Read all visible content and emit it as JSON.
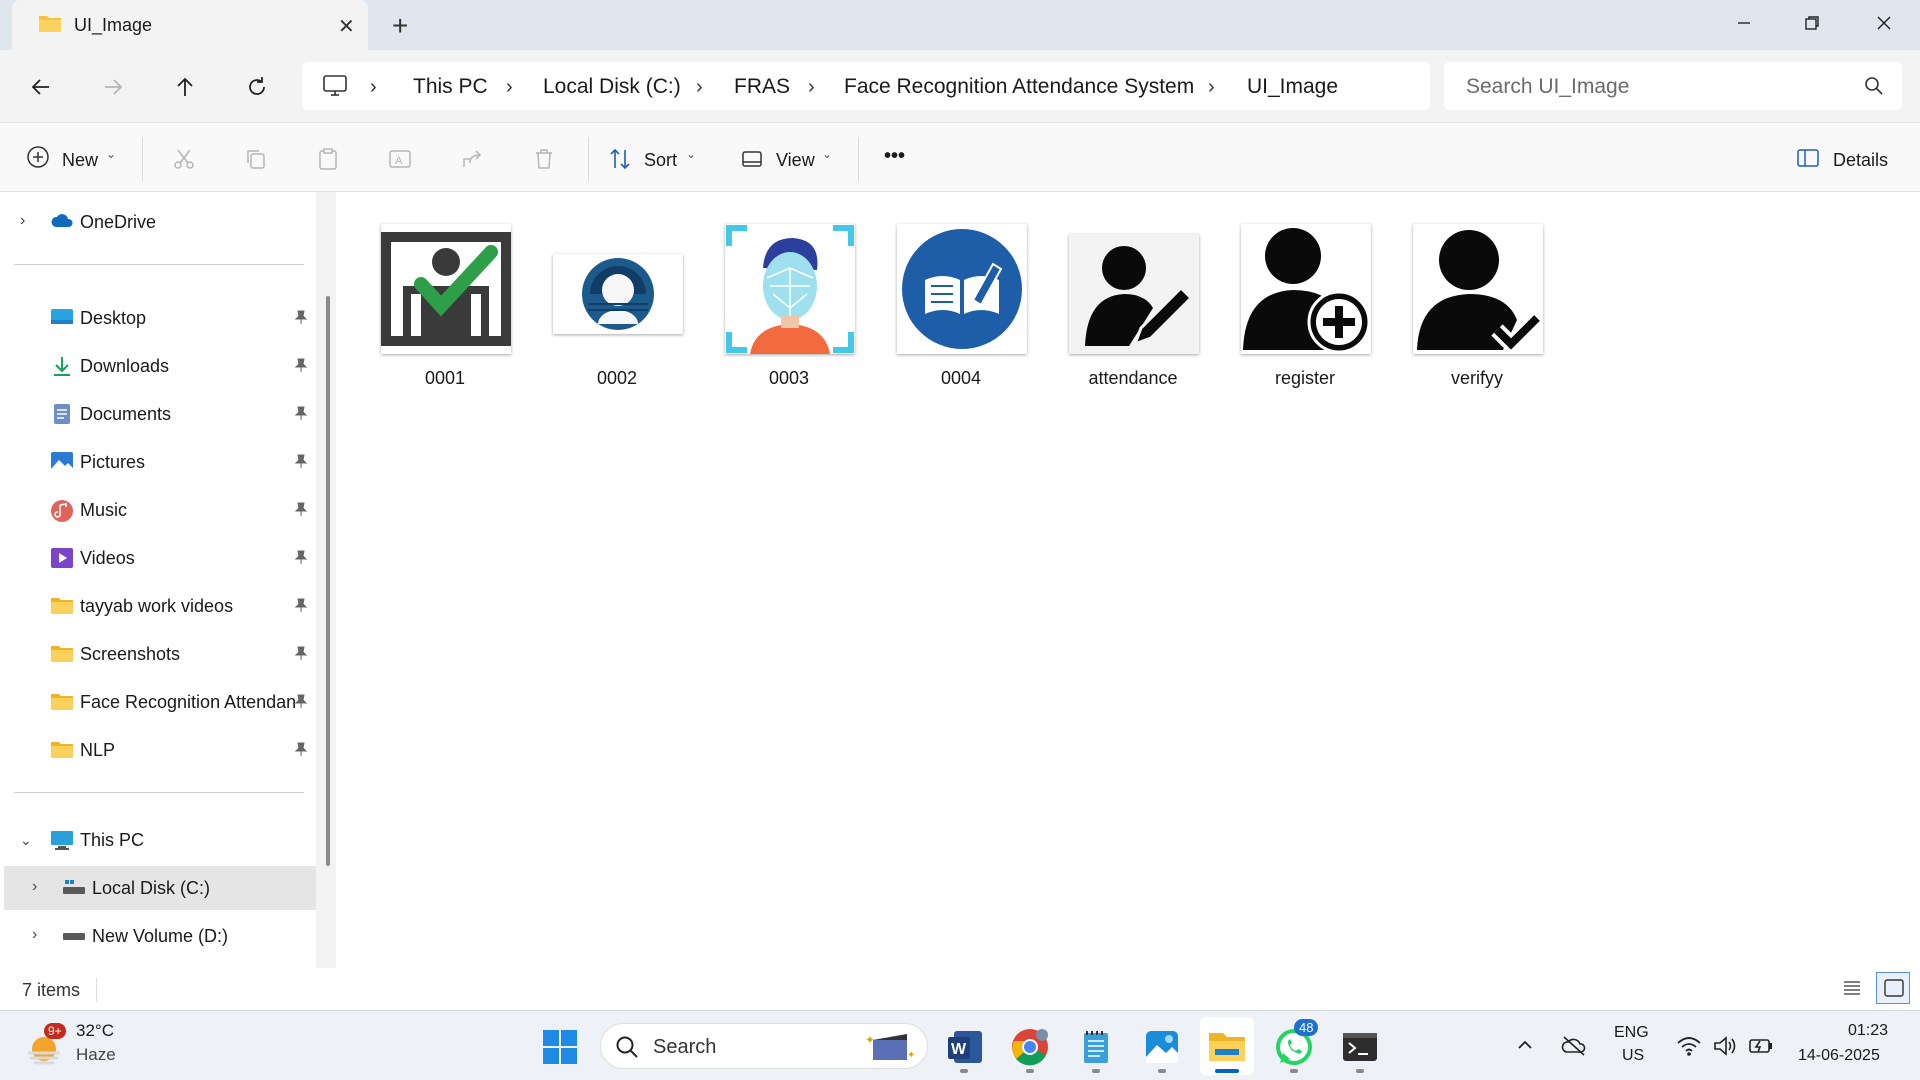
{
  "window": {
    "tab_title": "UI_Image",
    "new_tab_symbol": "+",
    "close_tab_symbol": "✕"
  },
  "nav": {
    "back": "arrow-left-icon",
    "forward": "arrow-right-icon",
    "up": "arrow-up-icon",
    "refresh": "refresh-icon"
  },
  "breadcrumb": [
    "This PC",
    "Local Disk (C:)",
    "FRAS",
    "Face Recognition Attendance System",
    "UI_Image"
  ],
  "search": {
    "placeholder": "Search UI_Image"
  },
  "toolbar": {
    "new_label": "New",
    "sort_label": "Sort",
    "view_label": "View",
    "more_label": "•••",
    "details_label": "Details"
  },
  "sidebar": {
    "onedrive": "OneDrive",
    "quick_access": [
      {
        "label": "Desktop",
        "icon": "desktop-icon"
      },
      {
        "label": "Downloads",
        "icon": "download-icon"
      },
      {
        "label": "Documents",
        "icon": "documents-icon"
      },
      {
        "label": "Pictures",
        "icon": "pictures-icon"
      },
      {
        "label": "Music",
        "icon": "music-icon"
      },
      {
        "label": "Videos",
        "icon": "videos-icon"
      },
      {
        "label": "tayyab work videos",
        "icon": "folder-icon"
      },
      {
        "label": "Screenshots",
        "icon": "folder-icon"
      },
      {
        "label": "Face Recognition Attendan",
        "icon": "folder-icon"
      },
      {
        "label": "NLP",
        "icon": "folder-icon"
      }
    ],
    "this_pc": "This PC",
    "drives": [
      {
        "label": "Local Disk (C:)",
        "selected": true
      },
      {
        "label": "New Volume (D:)",
        "selected": false
      }
    ]
  },
  "files": [
    {
      "name": "0001"
    },
    {
      "name": "0002"
    },
    {
      "name": "0003"
    },
    {
      "name": "0004"
    },
    {
      "name": "attendance"
    },
    {
      "name": "register"
    },
    {
      "name": "verifyy"
    }
  ],
  "status": {
    "item_count": "7 items"
  },
  "taskbar": {
    "weather_temp": "32°C",
    "weather_desc": "Haze",
    "weather_badge": "9+",
    "search_label": "Search",
    "whatsapp_badge": "48",
    "lang_top": "ENG",
    "lang_bottom": "US",
    "time": "01:23",
    "date": "14-06-2025"
  },
  "colors": {
    "accent": "#0067c0",
    "folder": "#f6c343",
    "selected_row": "#e5e5e5"
  }
}
